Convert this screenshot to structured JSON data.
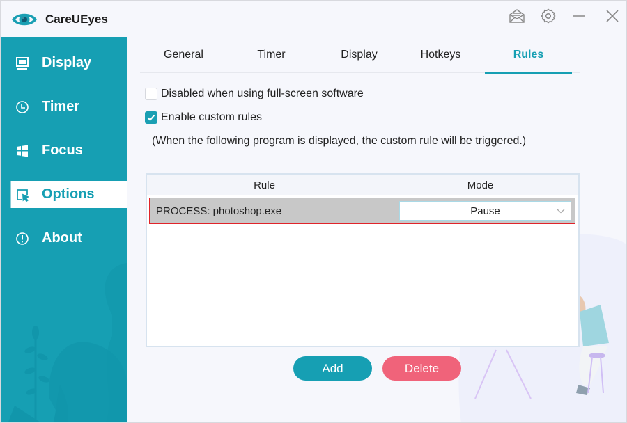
{
  "app": {
    "title": "CareUEyes",
    "icons": {
      "logo": "eye-icon",
      "feedback": "mail-open-icon",
      "settings": "gear-icon",
      "minimize": "minimize-icon",
      "close": "close-icon"
    }
  },
  "colors": {
    "accent": "#169fb3",
    "delete": "#f0637a",
    "selection_border": "#e0242a",
    "selected_row": "#c8c8c8"
  },
  "sidebar": {
    "items": [
      {
        "label": "Display",
        "icon": "monitor-icon",
        "active": false
      },
      {
        "label": "Timer",
        "icon": "clock-icon",
        "active": false
      },
      {
        "label": "Focus",
        "icon": "windows-icon",
        "active": false
      },
      {
        "label": "Options",
        "icon": "cursor-select-icon",
        "active": true
      },
      {
        "label": "About",
        "icon": "info-exclamation-icon",
        "active": false
      }
    ]
  },
  "tabs": [
    {
      "label": "General",
      "active": false
    },
    {
      "label": "Timer",
      "active": false
    },
    {
      "label": "Display",
      "active": false
    },
    {
      "label": "Hotkeys",
      "active": false
    },
    {
      "label": "Rules",
      "active": true
    }
  ],
  "options": {
    "fullscreen_disable": {
      "label": "Disabled when using full-screen software",
      "checked": false
    },
    "custom_rules": {
      "label": "Enable custom rules",
      "checked": true
    },
    "hint": "(When the following program is displayed, the custom rule will be triggered.)"
  },
  "rules_table": {
    "columns": [
      "Rule",
      "Mode"
    ],
    "rows": [
      {
        "rule": "PROCESS: photoshop.exe",
        "mode": "Pause",
        "selected": true
      }
    ]
  },
  "buttons": {
    "add": "Add",
    "delete": "Delete"
  }
}
